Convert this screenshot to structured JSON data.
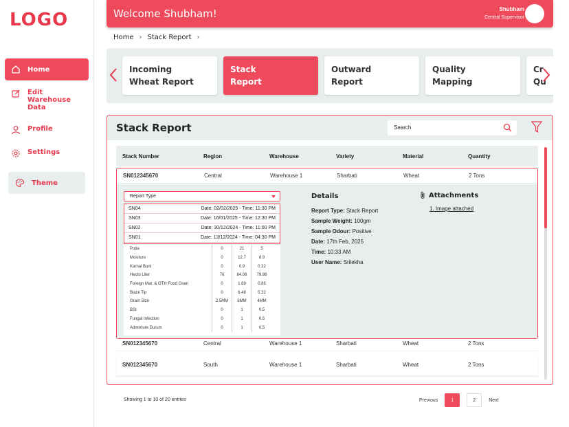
{
  "logo": "LOGO",
  "sidebar": {
    "items": [
      {
        "label": "Home",
        "icon": "home-icon"
      },
      {
        "label": "Edit Warehouse Data",
        "icon": "edit-icon"
      },
      {
        "label": "Profile",
        "icon": "user-icon"
      },
      {
        "label": "Settings",
        "icon": "gear-icon"
      }
    ],
    "theme_label": "Theme"
  },
  "header": {
    "welcome": "Welcome Shubham!",
    "user_name": "Shubham",
    "user_role": "Central Supervisor"
  },
  "breadcrumb": {
    "home": "Home",
    "current": "Stack Report"
  },
  "tabs": [
    {
      "line1": "Incoming",
      "line2": "Wheat Report"
    },
    {
      "line1": "Stack",
      "line2": "Report"
    },
    {
      "line1": "Outward",
      "line2": "Report"
    },
    {
      "line1": "Quality",
      "line2": "Mapping"
    },
    {
      "line1": "Cr",
      "line2": "Qu"
    }
  ],
  "panel": {
    "title": "Stack Report",
    "search_placeholder": "Search"
  },
  "table": {
    "headers": [
      "Stack Number",
      "Region",
      "Warehouse",
      "Variety",
      "Material",
      "Quantity"
    ],
    "expanded_row": [
      "SN012345670",
      "Central",
      "Warehouse 1",
      "Sharbati",
      "Wheat",
      "2 Tons"
    ],
    "rows": [
      [
        "SN012345670",
        "Central",
        "Warehouse 1",
        "Sharbati",
        "Wheat",
        "2 Tons"
      ],
      [
        "SN012345670",
        "South",
        "Warehouse 1",
        "Sharbati",
        "Wheat",
        "2 Tons"
      ]
    ]
  },
  "expanded": {
    "report_type_label": "Report Type",
    "report_list": [
      {
        "sn": "SN04",
        "dt": "Date: 02/02/2025 - Time: 11:30 PM"
      },
      {
        "sn": "SN03",
        "dt": "Date: 16/01/2025 - Time: 12:30 PM"
      },
      {
        "sn": "SN02",
        "dt": "Date: 30/12/2024 - Time: 11:00 PM"
      },
      {
        "sn": "SN01",
        "dt": "Date: 13/12/2024 - Time: 04:30 PM"
      }
    ],
    "parameters": [
      [
        "Potia",
        "0",
        "21",
        "5"
      ],
      [
        "Moisture",
        "0",
        "12.7",
        "8.9"
      ],
      [
        "Karnal Bunt",
        "0",
        "0.9",
        "0.32"
      ],
      [
        "Hecto Liter",
        "76",
        "84.06",
        "79.86"
      ],
      [
        "Foreign Mat. & OTH Food Grain",
        "0",
        "1.88",
        "0.86"
      ],
      [
        "Black Tip",
        "0",
        "6.48",
        "5.32"
      ],
      [
        "Grain Size",
        "2.5MM",
        "6MM",
        "4MM"
      ],
      [
        "BSI",
        "0",
        "1",
        "0.5"
      ],
      [
        "Fungal Infection",
        "0",
        "1",
        "0.5"
      ],
      [
        "Admixture Durum",
        "0",
        "1",
        "0.5"
      ]
    ],
    "details": {
      "heading": "Details",
      "report_type_k": "Report Type:",
      "report_type_v": "Stack Report",
      "sample_weight_k": "Sample Weight:",
      "sample_weight_v": "100gm",
      "sample_odour_k": "Sample Odour:",
      "sample_odour_v": "Positive",
      "date_k": "Date:",
      "date_v": "17th Feb, 2025",
      "time_k": "Time:",
      "time_v": "10:33 AM",
      "user_k": "User Name:",
      "user_v": "Srilekha"
    },
    "attachments": {
      "heading": "Attachments",
      "item": "1. Image attached"
    }
  },
  "footer": {
    "info": "Showing 1 to 10 of 20 entries",
    "previous": "Previous",
    "pages": [
      "1",
      "2"
    ],
    "next": "Next"
  },
  "colors": {
    "accent": "#ef4a5c",
    "panel_bg": "#e8eeee"
  }
}
